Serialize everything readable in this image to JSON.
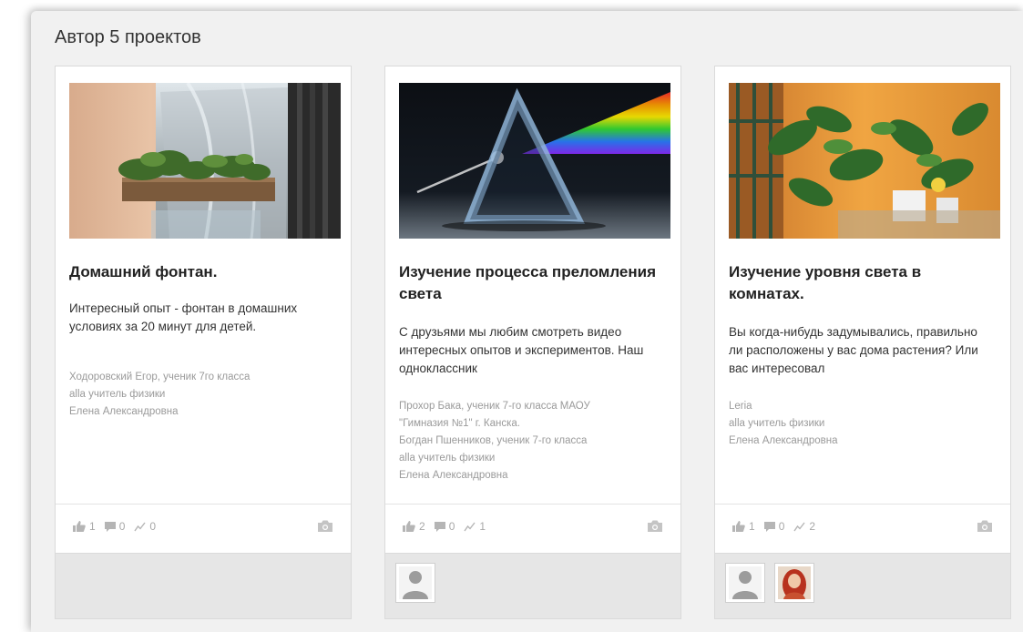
{
  "section": {
    "title": "Автор 5 проектов"
  },
  "cards": [
    {
      "title": "Домашний фонтан.",
      "description": "Интересный опыт - фонтан в домашних условиях за 20 минут для детей.",
      "authors": [
        "Ходоровский Егор, ученик 7го класса",
        "alla учитель физики",
        "Елена Александровна"
      ],
      "likes": "1",
      "comments": "0",
      "views": "0",
      "thumbnail_icon": "fountain-image"
    },
    {
      "title": "Изучение процесса преломления света",
      "description": "С друзьями мы любим смотреть видео интересных опытов и экспериментов. Наш одноклассник",
      "authors": [
        "Прохор Бака, ученик 7-го класса МАОУ",
        "\"Гимназия №1\" г. Канска.",
        "Богдан Пшенников, ученик 7-го класса",
        "alla учитель физики",
        "Елена Александровна"
      ],
      "likes": "2",
      "comments": "0",
      "views": "1",
      "thumbnail_icon": "prism-image"
    },
    {
      "title": "Изучение уровня света в комнатах.",
      "description": "Вы когда-нибудь задумывались, правильно ли расположены у вас дома растения? Или вас интересовал",
      "authors": [
        "Leria",
        "alla учитель физики",
        "Елена Александровна"
      ],
      "likes": "1",
      "comments": "0",
      "views": "2",
      "thumbnail_icon": "plants-image"
    }
  ],
  "colors": {
    "panel_bg": "#f1f1f1",
    "meta_text": "#9a9a9a",
    "stat_icon": "#b5b5b5"
  }
}
